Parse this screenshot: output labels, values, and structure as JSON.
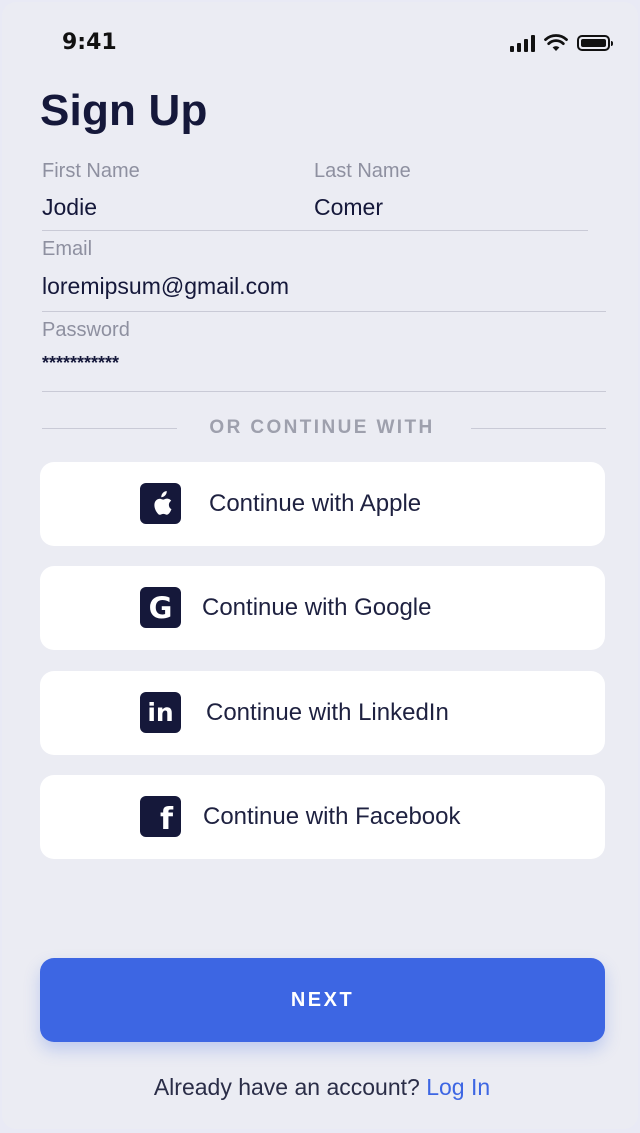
{
  "status_bar": {
    "time": "9:41"
  },
  "title": "Sign Up",
  "form": {
    "first_name": {
      "label": "First Name",
      "value": "Jodie"
    },
    "last_name": {
      "label": "Last Name",
      "value": "Comer"
    },
    "email": {
      "label": "Email",
      "value": "loremipsum@gmail.com"
    },
    "password": {
      "label": "Password",
      "value": "***********"
    }
  },
  "divider_text": "OR CONTINUE WITH",
  "social": {
    "apple": {
      "label": "Continue with Apple",
      "icon": "apple-icon"
    },
    "google": {
      "label": "Continue with Google",
      "icon": "google-icon",
      "glyph": "G"
    },
    "linkedin": {
      "label": "Continue with LinkedIn",
      "icon": "linkedin-icon",
      "glyph": "in"
    },
    "facebook": {
      "label": "Continue with Facebook",
      "icon": "facebook-icon",
      "glyph": "f"
    }
  },
  "next_button": "NEXT",
  "footer": {
    "prompt": "Already have an account?",
    "link": "Log In"
  },
  "colors": {
    "accent": "#3D66E3",
    "dark": "#15183A",
    "background": "#EBECF3"
  }
}
